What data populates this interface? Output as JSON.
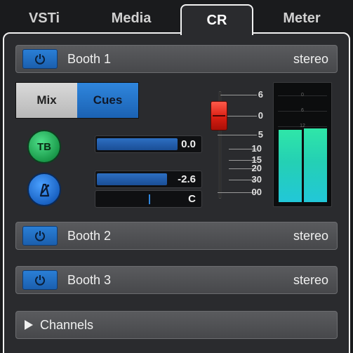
{
  "tabs": [
    {
      "label": "VSTi"
    },
    {
      "label": "Media"
    },
    {
      "label": "CR"
    },
    {
      "label": "Meter"
    }
  ],
  "active_tab": "CR",
  "booths": [
    {
      "name": "Booth 1",
      "mode": "stereo"
    },
    {
      "name": "Booth 2",
      "mode": "stereo"
    },
    {
      "name": "Booth 3",
      "mode": "stereo"
    }
  ],
  "toggle": {
    "mix_label": "Mix",
    "cues_label": "Cues",
    "active": "Cues"
  },
  "talkback": {
    "label": "TB"
  },
  "fields": {
    "talkback_level": "0.0",
    "talkback_level_fraction": 0.78,
    "click_level": "-2.6",
    "click_level_fraction": 0.68,
    "pan": "C"
  },
  "fader": {
    "scale_labels": [
      "6",
      "0",
      "5",
      "10",
      "15",
      "20",
      "30",
      "00"
    ],
    "value_db": 0
  },
  "meter": {
    "grid_labels": [
      "0",
      "6",
      "12"
    ],
    "left_level": 0.62,
    "right_level": 0.63,
    "colors": {
      "top": "#2fe6a8",
      "bottom": "#22c7d8"
    }
  },
  "channels": {
    "label": "Channels"
  },
  "colors": {
    "accent_blue": "#1b62b3",
    "talkback_green": "#1a9a4a",
    "fader_red": "#d81e12"
  }
}
